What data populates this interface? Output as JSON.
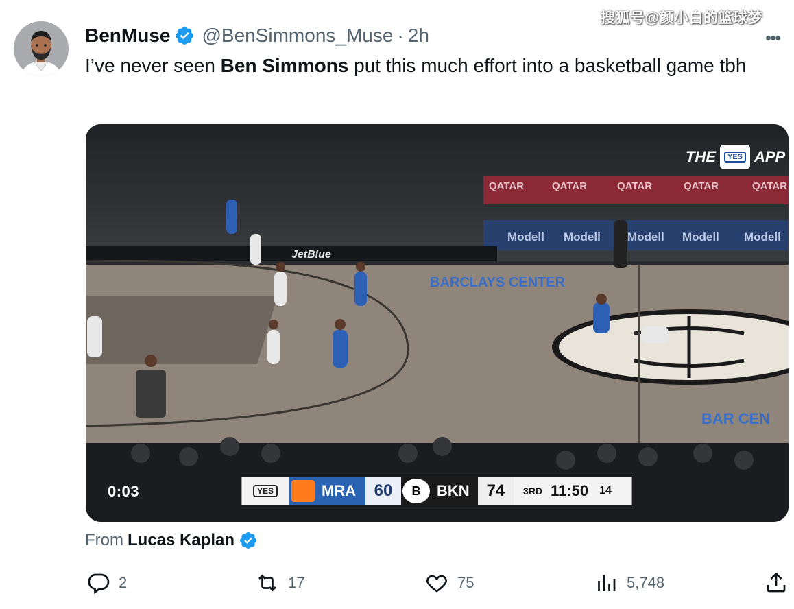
{
  "watermark": "搜狐号@颜小白的篮球梦",
  "tweet": {
    "display_name": "BenMuse",
    "handle": "@BenSimmons_Muse",
    "separator": "·",
    "time": "2h",
    "more_label": "•••",
    "text_before": "I’ve never seen ",
    "text_bold": "Ben Simmons",
    "text_after": " put this much effort into a basketball game tbh"
  },
  "media": {
    "duration": "0:03",
    "app_logo": {
      "left": "THE",
      "box": "YES",
      "right": "APP"
    },
    "scoreboard": {
      "network": "YES",
      "team1": "MRA",
      "team1_score": "60",
      "team2": "BKN",
      "team2_logo": "B",
      "team2_score": "74",
      "quarter": "3RD",
      "clock": "11:50",
      "shot_clock": "14"
    },
    "court_text": {
      "sponsor": "JetBlue",
      "arena": "BARCLAYS CENTER",
      "arena_right": "BAR CEN"
    }
  },
  "from": {
    "label": "From",
    "name": "Lucas Kaplan"
  },
  "actions": {
    "reply": {
      "icon": "reply-icon",
      "count": "2"
    },
    "retweet": {
      "icon": "retweet-icon",
      "count": "17"
    },
    "like": {
      "icon": "heart-icon",
      "count": "75"
    },
    "views": {
      "icon": "views-icon",
      "count": "5,748"
    },
    "share": {
      "icon": "share-icon"
    }
  },
  "colors": {
    "verified": "#1d9bf0",
    "text": "#0f1419",
    "secondary": "#536471"
  }
}
